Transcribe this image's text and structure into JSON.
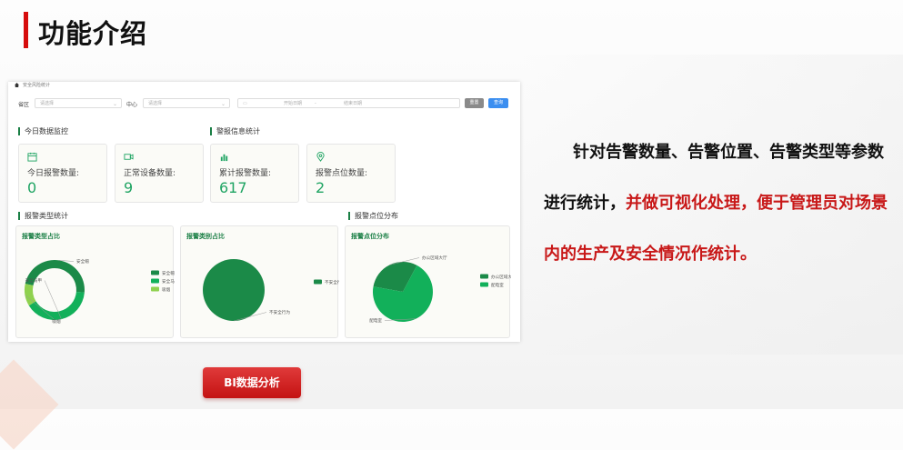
{
  "page": {
    "title": "功能介绍"
  },
  "screenshot": {
    "breadcrumb": "安全风险统计",
    "filters": {
      "province_label": "省区",
      "province_placeholder": "请选择",
      "center_label": "中心",
      "center_placeholder": "请选择",
      "start_date": "开始日期",
      "date_sep": "-",
      "end_date": "结束日期",
      "reset_label": "重置",
      "query_label": "查询"
    },
    "sections": {
      "today_monitor": "今日数据监控",
      "alarm_stats": "警报信息统计",
      "alarm_type_stats": "报警类型统计",
      "alarm_point_dist": "报警点位分布"
    },
    "cards": [
      {
        "icon": "calendar-icon",
        "label": "今日报警数量:",
        "value": "0"
      },
      {
        "icon": "camera-icon",
        "label": "正常设备数量:",
        "value": "9"
      },
      {
        "icon": "bar-chart-icon",
        "label": "累计报警数量:",
        "value": "617"
      },
      {
        "icon": "location-pin-icon",
        "label": "报警点位数量:",
        "value": "2"
      }
    ],
    "accent_color": "#1fa463"
  },
  "chart_data": [
    {
      "type": "pie",
      "title": "报警类型占比",
      "donut": true,
      "labels": [
        "安全帽",
        "安全马甲",
        "吸烟"
      ],
      "values": [
        48,
        40,
        12
      ],
      "colors": [
        "#1b8a48",
        "#12b05a",
        "#8fd14f"
      ],
      "legend": [
        "安全帽",
        "安全马甲",
        "吸烟"
      ],
      "legend_position": "right"
    },
    {
      "type": "pie",
      "title": "报警类别占比",
      "labels": [
        "不安全行为"
      ],
      "values": [
        100
      ],
      "colors": [
        "#1b8a48"
      ],
      "legend": [
        "不安全行为"
      ],
      "legend_position": "right"
    },
    {
      "type": "pie",
      "title": "报警点位分布",
      "labels": [
        "办公区域大厅",
        "配电室"
      ],
      "values": [
        30,
        70
      ],
      "colors": [
        "#1b8a48",
        "#12b05a"
      ],
      "legend": [
        "办公区域大厅",
        "配电室"
      ],
      "legend_position": "right"
    }
  ],
  "description": {
    "part1": "针对告警数量、告警位置、告警类型等参数进行统计，",
    "part2": "并做可视化处理，便于管理员对场景内的生产及安全情况作统计。"
  },
  "bi_button": {
    "label": "BI数据分析"
  }
}
